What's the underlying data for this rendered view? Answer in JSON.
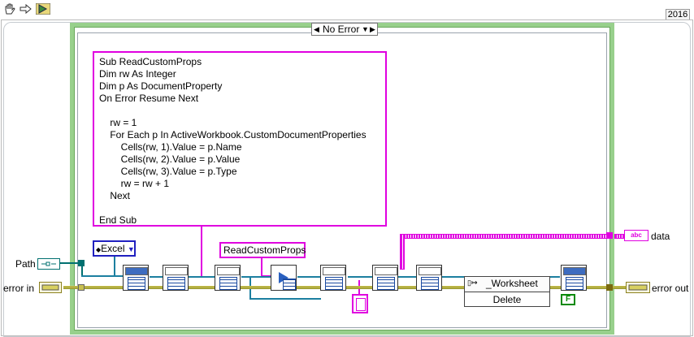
{
  "toolbar": {
    "icons": [
      "hand-icon",
      "arrow-icon",
      "run-icon"
    ],
    "version": "2016"
  },
  "case_structure": {
    "selector_label": "No Error",
    "selector_arrows": {
      "left": "◀",
      "down": "▼",
      "right": "▶"
    }
  },
  "macro_code": "Sub ReadCustomProps\nDim rw As Integer\nDim p As DocumentProperty\nOn Error Resume Next\n\n    rw = 1\n    For Each p In ActiveWorkbook.CustomDocumentProperties\n        Cells(rw, 1).Value = p.Name\n        Cells(rw, 2).Value = p.Value\n        Cells(rw, 3).Value = p.Type\n        rw = rw + 1\n    Next\n\nEnd Sub",
  "macro_name": "ReadCustomProps",
  "ring_constant": {
    "value": "Excel",
    "arrow": "▼",
    "prefix": "◆"
  },
  "controls": {
    "path_label": "Path",
    "error_in_label": "error in"
  },
  "indicators": {
    "data_label": "data",
    "error_out_label": "error out",
    "string_glyph": "abc"
  },
  "invoke_node": {
    "class_name": "_Worksheet",
    "method": "Delete"
  },
  "false_constant": "F",
  "colors": {
    "case_border": "#98d08c",
    "string_wire": "#e000e0",
    "ring_border": "#2020c0",
    "refnum_wire": "#1c7fa0",
    "error_wire": "#b8b040"
  }
}
